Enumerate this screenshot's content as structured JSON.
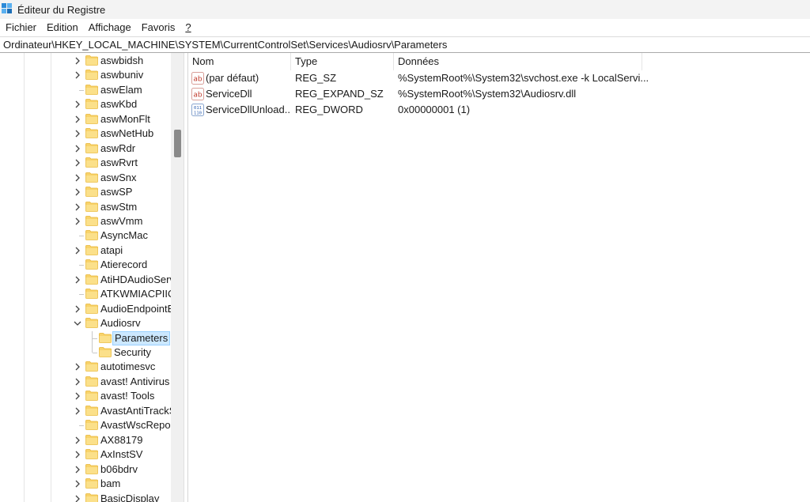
{
  "window": {
    "title": "Éditeur du Registre"
  },
  "menu": [
    "Fichier",
    "Edition",
    "Affichage",
    "Favoris",
    "?"
  ],
  "address": "Ordinateur\\HKEY_LOCAL_MACHINE\\SYSTEM\\CurrentControlSet\\Services\\Audiosrv\\Parameters",
  "tree": [
    {
      "label": "aswbidsh",
      "expandable": true
    },
    {
      "label": "aswbuniv",
      "expandable": true
    },
    {
      "label": "aswElam",
      "expandable": false
    },
    {
      "label": "aswKbd",
      "expandable": true
    },
    {
      "label": "aswMonFlt",
      "expandable": true
    },
    {
      "label": "aswNetHub",
      "expandable": true
    },
    {
      "label": "aswRdr",
      "expandable": true
    },
    {
      "label": "aswRvrt",
      "expandable": true
    },
    {
      "label": "aswSnx",
      "expandable": true
    },
    {
      "label": "aswSP",
      "expandable": true
    },
    {
      "label": "aswStm",
      "expandable": true
    },
    {
      "label": "aswVmm",
      "expandable": true
    },
    {
      "label": "AsyncMac",
      "expandable": false
    },
    {
      "label": "atapi",
      "expandable": true
    },
    {
      "label": "Atierecord",
      "expandable": false
    },
    {
      "label": "AtiHDAudioService",
      "expandable": true
    },
    {
      "label": "ATKWMIACPIIO",
      "expandable": false
    },
    {
      "label": "AudioEndpointBuilder",
      "expandable": true
    },
    {
      "label": "Audiosrv",
      "expandable": true,
      "expanded": true
    },
    {
      "label": "Parameters",
      "expandable": false,
      "child": true,
      "selected": true
    },
    {
      "label": "Security",
      "expandable": false,
      "child": true
    },
    {
      "label": "autotimesvc",
      "expandable": true
    },
    {
      "label": "avast! Antivirus",
      "expandable": true
    },
    {
      "label": "avast! Tools",
      "expandable": true
    },
    {
      "label": "AvastAntiTrackSvc",
      "expandable": true
    },
    {
      "label": "AvastWscReporter",
      "expandable": false
    },
    {
      "label": "AX88179",
      "expandable": true
    },
    {
      "label": "AxInstSV",
      "expandable": true
    },
    {
      "label": "b06bdrv",
      "expandable": true
    },
    {
      "label": "bam",
      "expandable": true
    },
    {
      "label": "BasicDisplay",
      "expandable": true
    }
  ],
  "list": {
    "columns": [
      "Nom",
      "Type",
      "Données"
    ],
    "rows": [
      {
        "icon": "string-value-icon",
        "name": "(par défaut)",
        "type": "REG_SZ",
        "data": "%SystemRoot%\\System32\\svchost.exe -k LocalServi..."
      },
      {
        "icon": "string-value-icon",
        "name": "ServiceDll",
        "type": "REG_EXPAND_SZ",
        "data": "%SystemRoot%\\System32\\Audiosrv.dll"
      },
      {
        "icon": "binary-value-icon",
        "name": "ServiceDllUnload...",
        "type": "REG_DWORD",
        "data": "0x00000001 (1)"
      }
    ]
  },
  "colors": {
    "selection": "#cce8ff",
    "selection_border": "#99d1ff",
    "folder": "#f8d36b",
    "folder_dark": "#e8b534",
    "string_icon": "#c0392b",
    "binary_icon": "#2a5db0"
  }
}
